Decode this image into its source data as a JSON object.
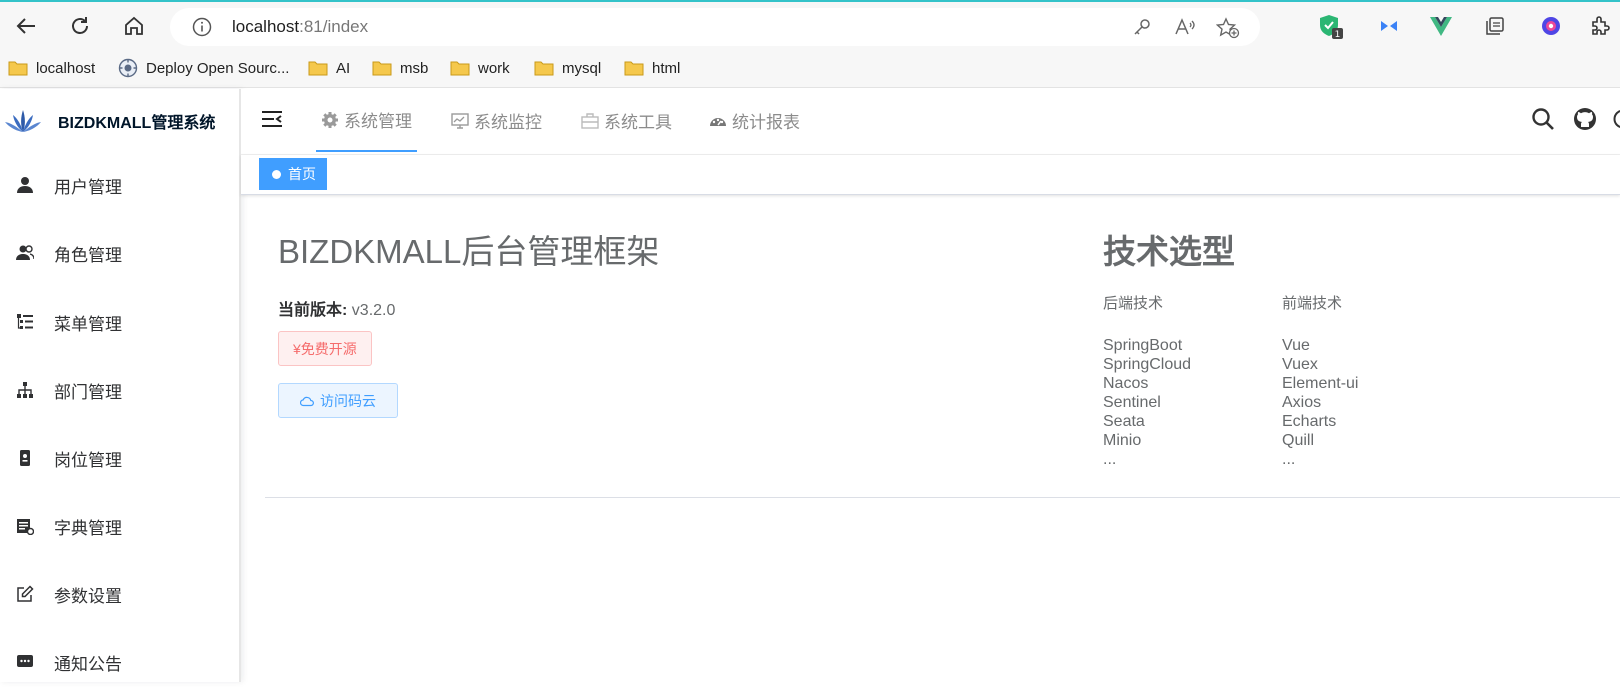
{
  "browser": {
    "url_host": "localhost",
    "url_rest": ":81/index",
    "extension_badge": "1",
    "bookmarks": [
      {
        "label": "localhost",
        "icon": "folder-icon"
      },
      {
        "label": "Deploy Open Sourc...",
        "icon": "globe-icon"
      },
      {
        "label": "AI",
        "icon": "folder-icon"
      },
      {
        "label": "msb",
        "icon": "folder-icon"
      },
      {
        "label": "work",
        "icon": "folder-icon"
      },
      {
        "label": "mysql",
        "icon": "folder-icon"
      },
      {
        "label": "html",
        "icon": "folder-icon"
      }
    ]
  },
  "app": {
    "logo_title": "BIZDKMALL管理系统"
  },
  "sidebar": {
    "items": [
      {
        "label": "用户管理",
        "icon": "user-icon"
      },
      {
        "label": "角色管理",
        "icon": "peoples-icon"
      },
      {
        "label": "菜单管理",
        "icon": "tree-table-icon"
      },
      {
        "label": "部门管理",
        "icon": "tree-icon"
      },
      {
        "label": "岗位管理",
        "icon": "post-icon"
      },
      {
        "label": "字典管理",
        "icon": "dict-icon"
      },
      {
        "label": "参数设置",
        "icon": "edit-icon"
      },
      {
        "label": "通知公告",
        "icon": "message-icon"
      }
    ]
  },
  "topnav": {
    "tabs": [
      {
        "label": "系统管理",
        "icon": "gear-icon",
        "active": true
      },
      {
        "label": "系统监控",
        "icon": "monitor-icon",
        "active": false
      },
      {
        "label": "系统工具",
        "icon": "toolbox-icon",
        "active": false
      },
      {
        "label": "统计报表",
        "icon": "dashboard-icon",
        "active": false
      }
    ]
  },
  "tags": {
    "home": "首页"
  },
  "main": {
    "title": "BIZDKMALL后台管理框架",
    "version_label": "当前版本:",
    "version_value": "v3.2.0",
    "free_button": "¥免费开源",
    "visit_button": "访问码云"
  },
  "tech": {
    "title": "技术选型",
    "backend_title": "后端技术",
    "frontend_title": "前端技术",
    "backend": [
      "SpringBoot",
      "SpringCloud",
      "Nacos",
      "Sentinel",
      "Seata",
      "Minio",
      "..."
    ],
    "frontend": [
      "Vue",
      "Vuex",
      "Element-ui",
      "Axios",
      "Echarts",
      "Quill",
      "..."
    ]
  },
  "colors": {
    "accent": "#409eff",
    "danger": "#f56c6c",
    "text": "#676a6c"
  }
}
